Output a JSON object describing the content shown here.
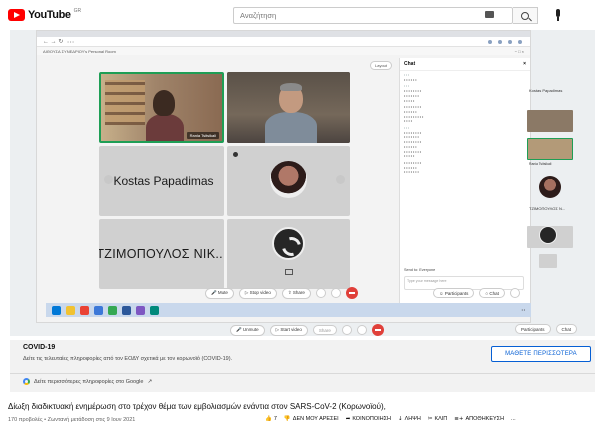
{
  "header": {
    "logo_text": "YouTube",
    "logo_country": "GR",
    "search_placeholder": "Αναζήτηση"
  },
  "meeting": {
    "room_title": "ΑΙΘΟΥΣΑ ΣΥΝΕΔΡΙΟΥ's Personal Room",
    "layout_label": "Layout",
    "tile1_label": "Rania Tsitsikali",
    "tile3_name": "Kostas Papadimas",
    "tile5_name": "ΤΖΙΜΟΠΟΥΛΟΣ ΝΙΚ...",
    "chat": {
      "title": "Chat",
      "send_to_label": "Send to:",
      "send_to_value": "Everyone",
      "input_placeholder": "Type your message here"
    },
    "rail": {
      "name1": "Kostas Papadimas",
      "name2": "Rania Tsitsikali",
      "name3": "ΤΖΙΜΟΠΟΥΛΟΣ Ν..."
    },
    "controls_top": {
      "mute": "Mute",
      "stop_video": "Stop video",
      "share": "Share",
      "participants": "Participants",
      "chat": "Chat"
    },
    "controls_bottom": {
      "unmute": "Unmute",
      "start_video": "Start video",
      "share": "Share",
      "participants": "Participants",
      "chat": "Chat"
    }
  },
  "covid_panel": {
    "title": "COVID-19",
    "description": "Δείτε τις τελευταίες πληροφορίες από τον ΕΟΔΥ σχετικά με τον κορωνοϊό (COVID-19).",
    "button_label": "ΜΑΘΕΤΕ ΠΕΡΙΣΣΟΤΕΡΑ",
    "google_link": "Δείτε περισσότερες πληροφορίες στο Google"
  },
  "video": {
    "title": "Δίωξη διαδικτυακή ενημέρωση στο τρέχον θέμα των εμβολιασμών ενάντια στον SARS-CoV-2 (Κορωνοϊού),",
    "meta": "170 προβολές • Ζωντανή μετάδοση στις 9 Ιουν 2021",
    "like_count": "7",
    "dislike_label": "ΔΕΝ ΜΟΥ ΑΡΕΣΕΙ",
    "share_label": "ΚΟΙΝΟΠΟΙΗΣΗ",
    "download_label": "ΛΗΨΗ",
    "clip_label": "ΚΛΙΠ",
    "save_label": "ΑΠΟΘΗΚΕΥΣΗ",
    "more_label": "..."
  },
  "colors": {
    "brand_red": "#ff0000",
    "link_blue": "#065fd4",
    "active_speaker_green": "#1e9e55",
    "end_call_red": "#e0403a"
  }
}
